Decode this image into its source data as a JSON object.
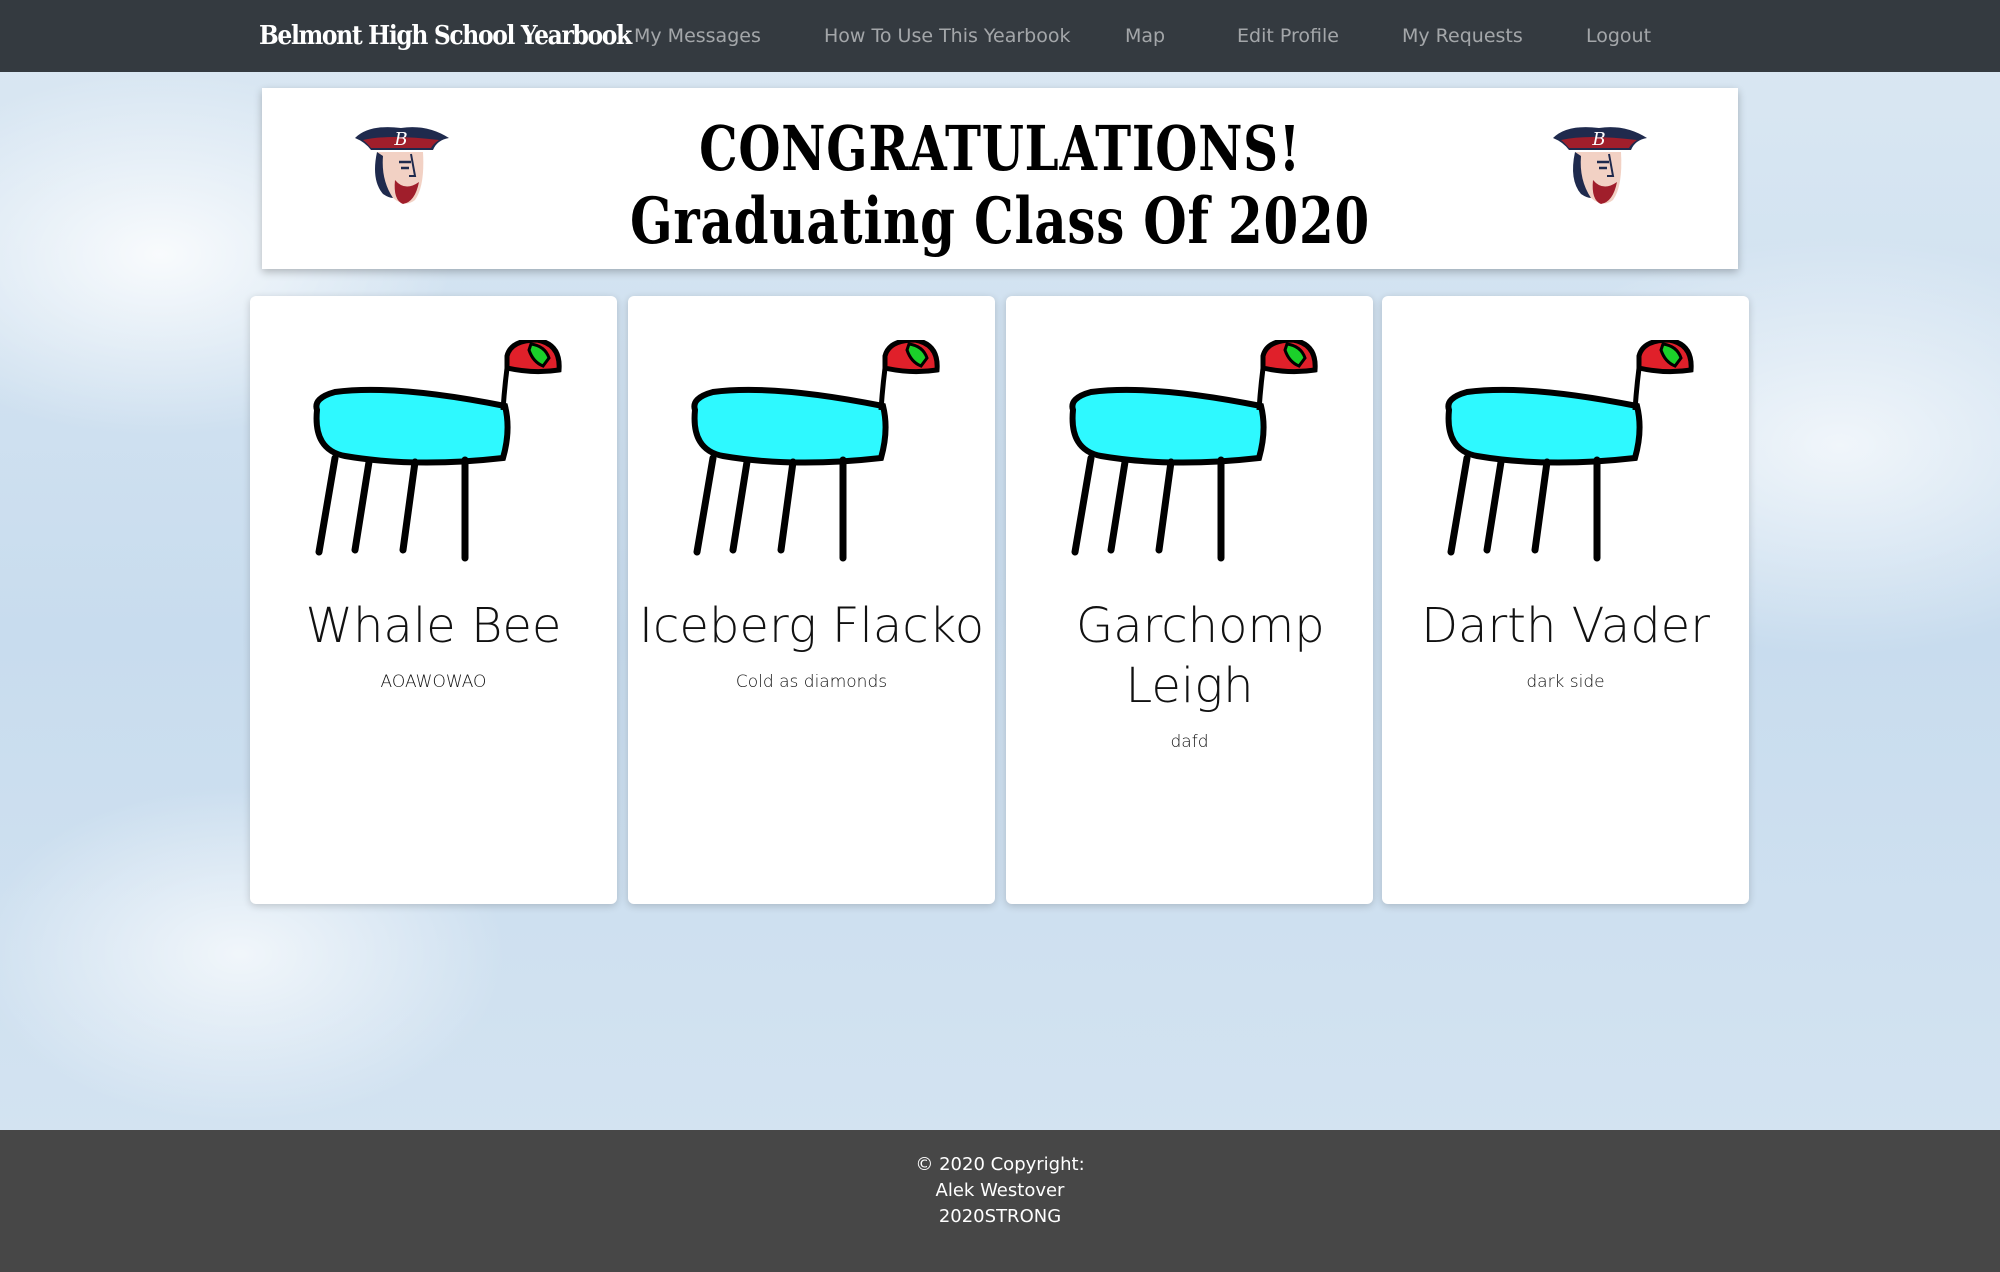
{
  "navbar": {
    "brand": "Belmont High School Yearbook",
    "items": [
      {
        "label": "My Messages"
      },
      {
        "label": "How To Use This Yearbook"
      },
      {
        "label": "Map"
      },
      {
        "label": "Edit Profile"
      },
      {
        "label": "My Requests"
      },
      {
        "label": "Logout"
      }
    ]
  },
  "banner": {
    "line1": "CONGRATULATIONS!",
    "line2": "Graduating Class Of 2020"
  },
  "cards": [
    {
      "name": "Whale Bee",
      "caption": "AOAWOWAO"
    },
    {
      "name": "Iceberg Flacko",
      "caption": "Cold as diamonds"
    },
    {
      "name": "Garchomp Leigh",
      "caption": "dafd"
    },
    {
      "name": "Darth Vader",
      "caption": "dark side"
    }
  ],
  "footer": {
    "line1": "© 2020 Copyright:",
    "line2": "Alek Westover",
    "line3": "2020STRONG"
  },
  "colors": {
    "navbar": "#343a40",
    "footer": "#474747",
    "creature_body": "#2ef9ff",
    "mascot_navy": "#1f2a4d",
    "mascot_red": "#a01e2b"
  }
}
